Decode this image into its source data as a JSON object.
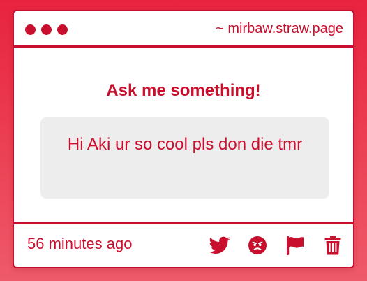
{
  "window": {
    "url": "~ mirbaw.straw.page"
  },
  "card": {
    "heading": "Ask me something!",
    "message": "Hi Aki ur so cool pls don die tmr",
    "timestamp": "56 minutes ago"
  },
  "actions": [
    {
      "icon": "twitter-icon"
    },
    {
      "icon": "angry-face-icon"
    },
    {
      "icon": "flag-icon"
    },
    {
      "icon": "trash-icon"
    }
  ],
  "colors": {
    "accent": "#c8102e",
    "background": "#e8233f",
    "message_bg": "#ededee"
  }
}
